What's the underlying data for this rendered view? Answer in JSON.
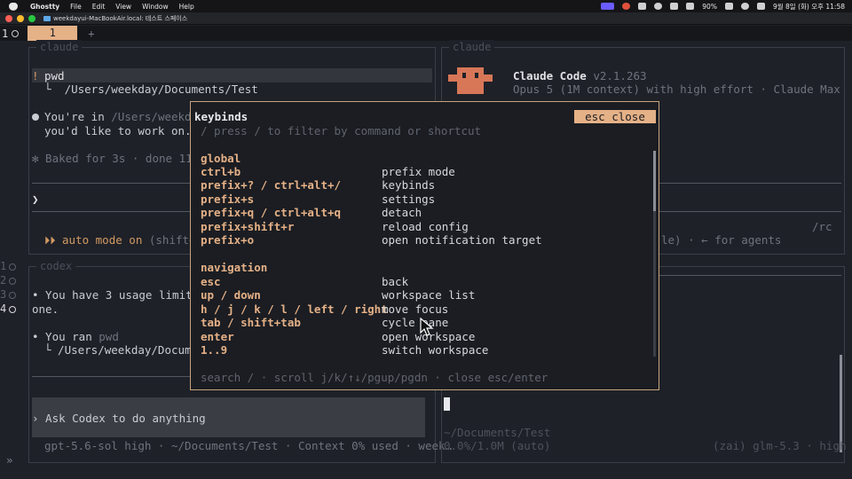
{
  "menubar": {
    "app": "Ghostty",
    "items": [
      "File",
      "Edit",
      "View",
      "Window",
      "Help"
    ],
    "battery": "90%",
    "clock": "9월 8일 (화) 오후 11:58"
  },
  "window": {
    "title": "weekdayui-MacBookAir.local: 테스트 스페이스"
  },
  "tabbar": {
    "workspace_num": "1",
    "tab_label": "1",
    "new_tab": "+"
  },
  "gutter": [
    {
      "num": "1"
    },
    {
      "num": "2"
    },
    {
      "num": "3"
    },
    {
      "num": "4"
    }
  ],
  "pane_claude_left": {
    "title": "claude",
    "cmd_marker": "!",
    "cmd": "pwd",
    "cmd_output": "└  /Users/weekday/Documents/Test",
    "msg_line1_prefix": "You're in ",
    "msg_line1_path": "/Users/weekda",
    "msg_line2": "you'd like to work on.",
    "baked": "✻ Baked for 3s · done 11:",
    "prompt": "❯",
    "mode_prefix": "⏵⏵ ",
    "mode": "auto mode on",
    "mode_suffix": " (shift+"
  },
  "pane_claude_right": {
    "title": "claude",
    "app_name": "Claude Code",
    "version": "v2.1.263",
    "model_line": "Opus 5 (1M context) with high effort · Claude Max",
    "rc": "/rc",
    "agents_hint": "le) · ← for agents"
  },
  "pane_codex": {
    "title": "codex",
    "usage_line1": "• You have 3 usage limit",
    "usage_line2": "one.",
    "ran_prefix": "• You ran ",
    "ran_cmd": "pwd",
    "ran_output": "└ /Users/weekday/Docume",
    "input_placeholder": "› Ask Codex to do anything",
    "status": "gpt-5.6-sol high · ~/Documents/Test · Context 0% used · week…"
  },
  "pane_bottom_right": {
    "cwd": "~/Documents/Test",
    "usage": "0.0%/1.0M (auto)",
    "model": "(zai) glm-5.3 · high"
  },
  "chevron": "»",
  "keybinds": {
    "title": "keybinds",
    "close_label": "esc close",
    "filter_hint": "/ press / to filter by command or shortcut",
    "sections": [
      {
        "name": "global",
        "rows": [
          {
            "key": "ctrl+b",
            "action": "prefix mode"
          },
          {
            "key": "prefix+? / ctrl+alt+/",
            "action": "keybinds"
          },
          {
            "key": "prefix+s",
            "action": "settings"
          },
          {
            "key": "prefix+q / ctrl+alt+q",
            "action": "detach"
          },
          {
            "key": "prefix+shift+r",
            "action": "reload config"
          },
          {
            "key": "prefix+o",
            "action": "open notification target"
          }
        ]
      },
      {
        "name": "navigation",
        "rows": [
          {
            "key": "esc",
            "action": "back"
          },
          {
            "key": "up / down",
            "action": "workspace list"
          },
          {
            "key": "h / j / k / l / left / right",
            "action": "move focus"
          },
          {
            "key": "tab / shift+tab",
            "action": "cycle pane"
          },
          {
            "key": "enter",
            "action": "open workspace"
          },
          {
            "key": "1..9",
            "action": "switch workspace"
          }
        ]
      }
    ],
    "footer": "search / · scroll j/k/↑↓/pgup/pgdn · close esc/enter"
  }
}
